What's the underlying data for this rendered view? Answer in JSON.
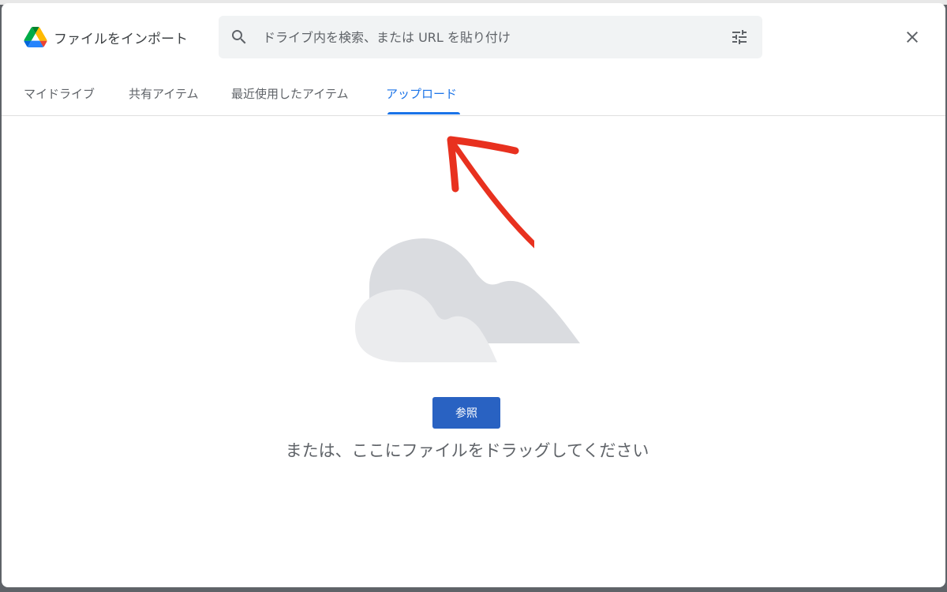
{
  "dialog": {
    "title": "ファイルをインポート",
    "logo_icon": "google-drive-icon",
    "close_icon": "close-icon"
  },
  "search": {
    "placeholder": "ドライブ内を検索、または URL を貼り付け",
    "value": "",
    "search_icon": "search-icon",
    "filter_icon": "tune-icon"
  },
  "tabs": [
    {
      "label": "マイドライブ",
      "active": false
    },
    {
      "label": "共有アイテム",
      "active": false
    },
    {
      "label": "最近使用したアイテム",
      "active": false
    },
    {
      "label": "アップロード",
      "active": true
    }
  ],
  "upload": {
    "illustration_icon": "cloud-illustration",
    "browse_label": "参照",
    "drag_text": "または、ここにファイルをドラッグしてください"
  },
  "colors": {
    "accent": "#1a73e8",
    "button": "#2962c2",
    "annotation": "#e8311f"
  }
}
